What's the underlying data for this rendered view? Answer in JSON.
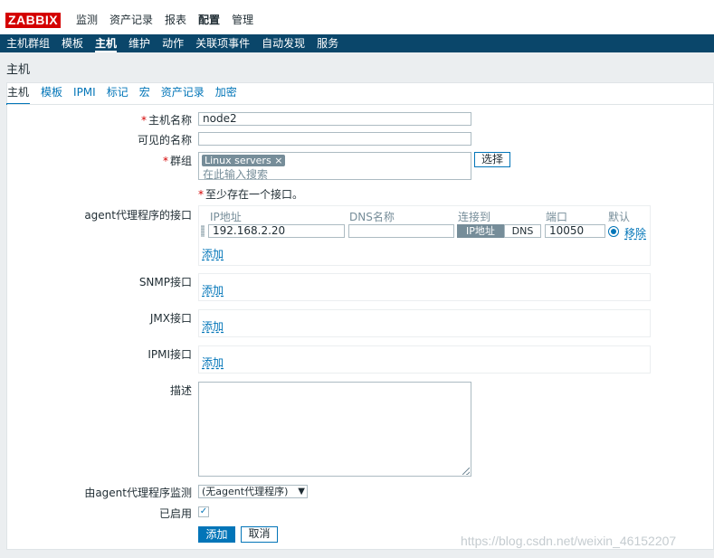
{
  "brand": {
    "logo": "ZABBIX",
    "color": "#d40000"
  },
  "top_nav": {
    "items": [
      "监测",
      "资产记录",
      "报表",
      "配置",
      "管理"
    ],
    "active": "配置"
  },
  "sub_nav": {
    "items": [
      "主机群组",
      "模板",
      "主机",
      "维护",
      "动作",
      "关联项事件",
      "自动发现",
      "服务"
    ],
    "active": "主机"
  },
  "page_title": "主机",
  "tabs": {
    "items": [
      "主机",
      "模板",
      "IPMI",
      "标记",
      "宏",
      "资产记录",
      "加密"
    ],
    "active": "主机"
  },
  "form": {
    "host_name": {
      "label": "主机名称",
      "value": "node2",
      "required": "*"
    },
    "visible_name": {
      "label": "可见的名称",
      "value": ""
    },
    "groups": {
      "label": "群组",
      "required": "*",
      "tag": "Linux servers",
      "tag_remove": "×",
      "placeholder": "在此输入搜索",
      "select_label": "选择"
    },
    "interface_note": {
      "required": "*",
      "text": "至少存在一个接口。"
    },
    "agent_interfaces": {
      "label": "agent代理程序的接口",
      "headers": [
        "IP地址",
        "DNS名称",
        "连接到",
        "端口",
        "默认"
      ],
      "row": {
        "ip": "192.168.2.20",
        "dns": "",
        "connect_ip": "IP地址",
        "connect_dns": "DNS",
        "port": "10050",
        "remove": "移除"
      },
      "add": "添加"
    },
    "snmp_interfaces": {
      "label": "SNMP接口",
      "add": "添加"
    },
    "jmx_interfaces": {
      "label": "JMX接口",
      "add": "添加"
    },
    "ipmi_interfaces": {
      "label": "IPMI接口",
      "add": "添加"
    },
    "description": {
      "label": "描述",
      "value": ""
    },
    "proxy": {
      "label": "由agent代理程序监测",
      "value": "(无agent代理程序)"
    },
    "enabled": {
      "label": "已启用",
      "checked": true,
      "check_glyph": "✓"
    },
    "buttons": {
      "add": "添加",
      "cancel": "取消"
    }
  },
  "watermark": "https://blog.csdn.net/weixin_46152207",
  "colors": {
    "header_bg": "#0a466a",
    "link": "#0275b8",
    "primary_button": "#0275b8"
  }
}
